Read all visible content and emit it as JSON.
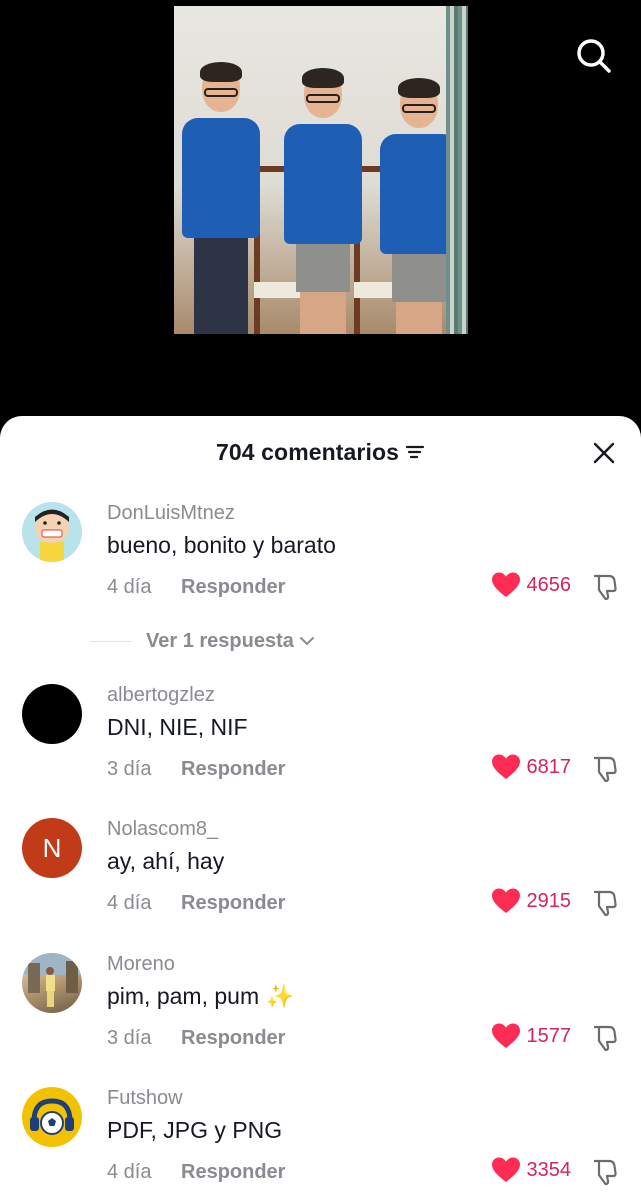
{
  "header": {
    "comments_title": "704 comentarios"
  },
  "icons": {
    "search": "search-icon",
    "sort": "sort-icon",
    "close": "close-icon",
    "like": "heart-icon",
    "dislike": "thumbs-down-icon",
    "chevron": "chevron-down-icon"
  },
  "colors": {
    "like_red": "#fe2c55",
    "like_count": "#d4245a",
    "muted_text": "#8a8b91",
    "primary_text": "#161823"
  },
  "comments": [
    {
      "user": "DonLuisMtnez",
      "text": "bueno, bonito y barato",
      "time": "4 día",
      "reply_label": "Responder",
      "likes": "4656"
    },
    {
      "user": "albertogzlez",
      "text": "DNI, NIE, NIF",
      "time": "3 día",
      "reply_label": "Responder",
      "likes": "6817"
    },
    {
      "user": "Nolascom8_",
      "avatar_letter": "N",
      "text": "ay, ahí, hay",
      "time": "4 día",
      "reply_label": "Responder",
      "likes": "2915"
    },
    {
      "user": "Moreno",
      "text": "pim, pam, pum ✨",
      "time": "3 día",
      "reply_label": "Responder",
      "likes": "1577"
    },
    {
      "user": "Futshow",
      "text": "PDF, JPG y PNG",
      "time": "4 día",
      "reply_label": "Responder",
      "likes": "3354"
    }
  ],
  "replies_link": "Ver 1 respuesta"
}
